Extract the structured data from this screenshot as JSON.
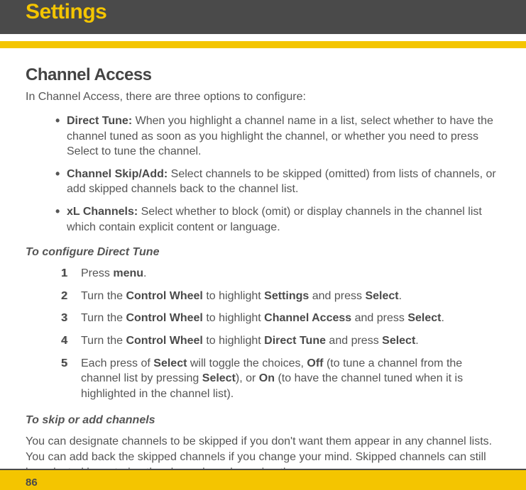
{
  "header": {
    "title": "Settings"
  },
  "section": {
    "heading": "Channel Access",
    "intro": "In Channel Access, there are three options to configure:",
    "bullets": [
      {
        "label": "Direct Tune:",
        "text": " When you highlight a channel name in a list, select whether to have the channel tuned as soon as you highlight the channel, or whether you need to press Select to tune the channel."
      },
      {
        "label": "Channel Skip/Add:",
        "text": " Select channels to be skipped (omitted) from lists of channels, or add skipped channels back to the channel list."
      },
      {
        "label": "xL Channels:",
        "text": " Select whether to block (omit) or display channels in the channel list which contain explicit content or language."
      }
    ],
    "procedure1": {
      "heading": "To configure Direct Tune",
      "steps": [
        {
          "num": "1",
          "parts": [
            "Press ",
            "menu",
            "."
          ]
        },
        {
          "num": "2",
          "parts": [
            "Turn the ",
            "Control Wheel",
            " to highlight ",
            "Settings",
            " and press ",
            "Select",
            "."
          ]
        },
        {
          "num": "3",
          "parts": [
            "Turn the ",
            "Control Wheel",
            " to highlight ",
            "Channel Access",
            " and press ",
            "Select",
            "."
          ]
        },
        {
          "num": "4",
          "parts": [
            "Turn the ",
            "Control Wheel",
            " to highlight ",
            "Direct Tune",
            " and press ",
            "Select",
            "."
          ]
        },
        {
          "num": "5",
          "parts": [
            "Each press of ",
            "Select",
            " will toggle the choices, ",
            "Off",
            " (to tune a channel from the channel list by pressing ",
            "Select",
            "), or ",
            "On",
            " (to have the channel tuned when it is highlighted in the channel list)."
          ]
        }
      ]
    },
    "procedure2": {
      "heading": "To skip or add channels",
      "para": "You can designate channels to be skipped if you don't want them appear in any channel lists. You can add back the skipped channels if you change your mind. Skipped channels can still be selected by entering the channel number using the"
    }
  },
  "footer": {
    "pageNumber": "86"
  }
}
